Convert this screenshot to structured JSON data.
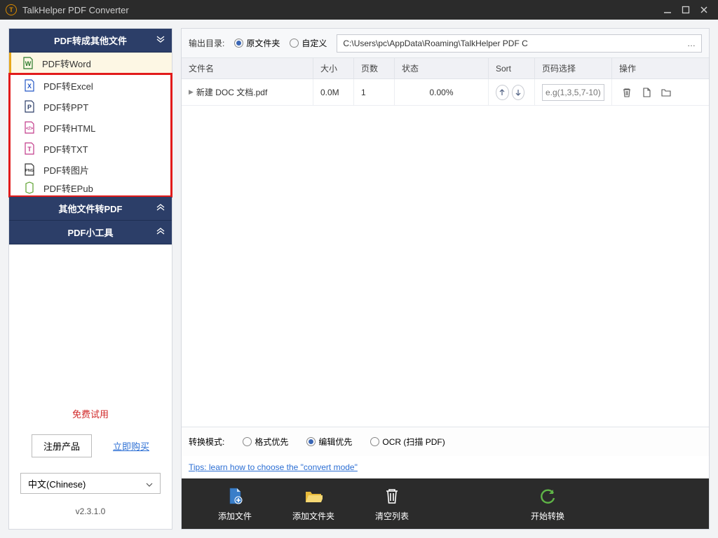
{
  "app": {
    "title": "TalkHelper PDF Converter"
  },
  "sidebar": {
    "section1_title": "PDF转成其他文件",
    "section2_title": "其他文件转PDF",
    "section3_title": "PDF小工具",
    "options": [
      {
        "label": "PDF转Word",
        "color": "#2b7a2b"
      },
      {
        "label": "PDF转Excel",
        "color": "#2457c5"
      },
      {
        "label": "PDF转PPT",
        "color": "#2c3e68"
      },
      {
        "label": "PDF转HTML",
        "color": "#c23a8a"
      },
      {
        "label": "PDF转TXT",
        "color": "#c23a8a"
      },
      {
        "label": "PDF转图片",
        "color": "#333333"
      },
      {
        "label": "PDF转EPub",
        "color": "#5aa02c"
      }
    ],
    "trial_label": "免费试用",
    "register_label": "注册产品",
    "buy_label": "立即购买",
    "language": "中文(Chinese)",
    "version": "v2.3.1.0"
  },
  "output": {
    "label": "输出目录:",
    "opt_original": "原文件夹",
    "opt_custom": "自定义",
    "path": "C:\\Users\\pc\\AppData\\Roaming\\TalkHelper PDF C"
  },
  "columns": {
    "name": "文件名",
    "size": "大小",
    "pages": "页数",
    "status": "状态",
    "sort": "Sort",
    "range": "页码选择",
    "ops": "操作"
  },
  "rows": [
    {
      "name": "新建 DOC 文档.pdf",
      "size": "0.0M",
      "pages": "1",
      "status": "0.00%",
      "range_placeholder": "e.g(1,3,5,7-10)"
    }
  ],
  "mode": {
    "label": "转换模式:",
    "opt_format": "格式优先",
    "opt_edit": "编辑优先",
    "opt_ocr": "OCR (扫描 PDF)"
  },
  "tips_text": "Tips: learn how to choose the \"convert mode\"",
  "actions": {
    "add_file": "添加文件",
    "add_folder": "添加文件夹",
    "clear": "清空列表",
    "start": "开始转换"
  }
}
